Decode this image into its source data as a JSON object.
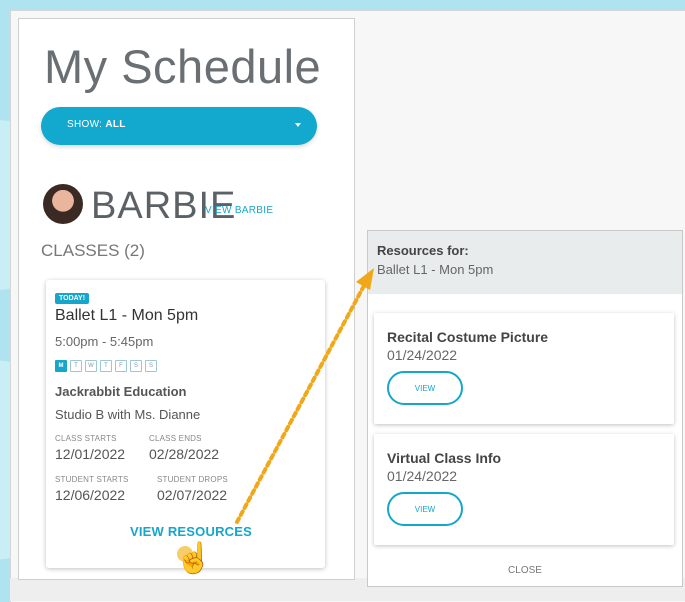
{
  "page": {
    "title": "My Schedule",
    "show_filter": {
      "prefix": "SHOW:",
      "value": "ALL"
    }
  },
  "student": {
    "name": "BARBIE",
    "view_link": "VIEW BARBIE",
    "classes_heading": "CLASSES (2)"
  },
  "class_card": {
    "badge": "TODAY!",
    "name": "Ballet L1 - Mon 5pm",
    "time": "5:00pm - 5:45pm",
    "days": [
      "M",
      "T",
      "W",
      "T",
      "F",
      "S",
      "S"
    ],
    "organization": "Jackrabbit Education",
    "studio": "Studio B with Ms. Dianne",
    "class_starts_label": "CLASS STARTS",
    "class_starts": "12/01/2022",
    "class_ends_label": "CLASS ENDS",
    "class_ends": "02/28/2022",
    "student_starts_label": "STUDENT STARTS",
    "student_starts": "12/06/2022",
    "student_drops_label": "STUDENT DROPS",
    "student_drops": "02/07/2022",
    "view_resources": "VIEW RESOURCES"
  },
  "resources_panel": {
    "title": "Resources for:",
    "subtitle": "Ballet L1 - Mon 5pm",
    "items": [
      {
        "title": "Recital Costume Picture",
        "date": "01/24/2022",
        "button": "VIEW"
      },
      {
        "title": "Virtual Class Info",
        "date": "01/24/2022",
        "button": "VIEW"
      }
    ],
    "close": "CLOSE"
  },
  "colors": {
    "accent": "#16a6cc",
    "page_background": "#aee3ef",
    "annotation_arrow": "#f0a818"
  },
  "icons": [
    "avatar-photo",
    "chevron-down-icon",
    "hand-pointer-cursor-icon",
    "dotted-arrow-annotation"
  ]
}
